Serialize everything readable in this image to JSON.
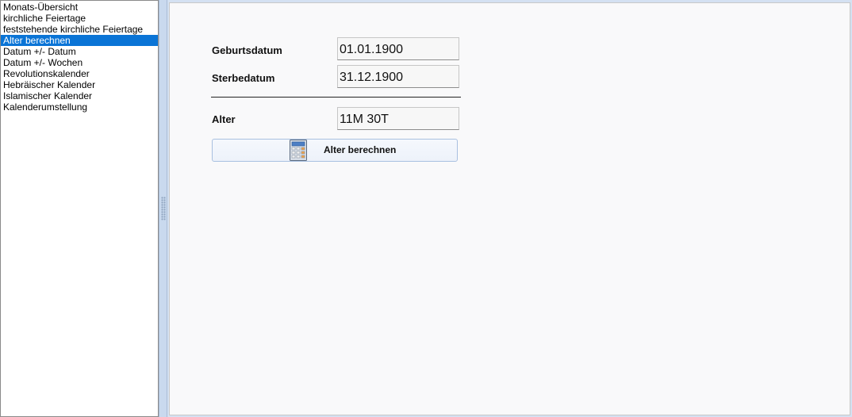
{
  "nav": {
    "items": [
      {
        "label": "Monats-Übersicht",
        "selected": false
      },
      {
        "label": "kirchliche Feiertage",
        "selected": false
      },
      {
        "label": "feststehende kirchliche Feiertage",
        "selected": false
      },
      {
        "label": "Alter berechnen",
        "selected": true
      },
      {
        "label": "Datum +/- Datum",
        "selected": false
      },
      {
        "label": "Datum +/- Wochen",
        "selected": false
      },
      {
        "label": "Revolutionskalender",
        "selected": false
      },
      {
        "label": "Hebräischer Kalender",
        "selected": false
      },
      {
        "label": "Islamischer Kalender",
        "selected": false
      },
      {
        "label": "Kalenderumstellung",
        "selected": false
      }
    ]
  },
  "form": {
    "birth_label": "Geburtsdatum",
    "birth_value": "01.01.1900",
    "death_label": "Sterbedatum",
    "death_value": "31.12.1900",
    "age_label": "Alter",
    "age_value": "11M 30T",
    "calc_button_label": "Alter berechnen",
    "calc_button_icon": "calculator-icon"
  },
  "colors": {
    "selection": "#0a74d6",
    "splitter": "#c9d9ee",
    "button_border": "#a9c0e0"
  }
}
